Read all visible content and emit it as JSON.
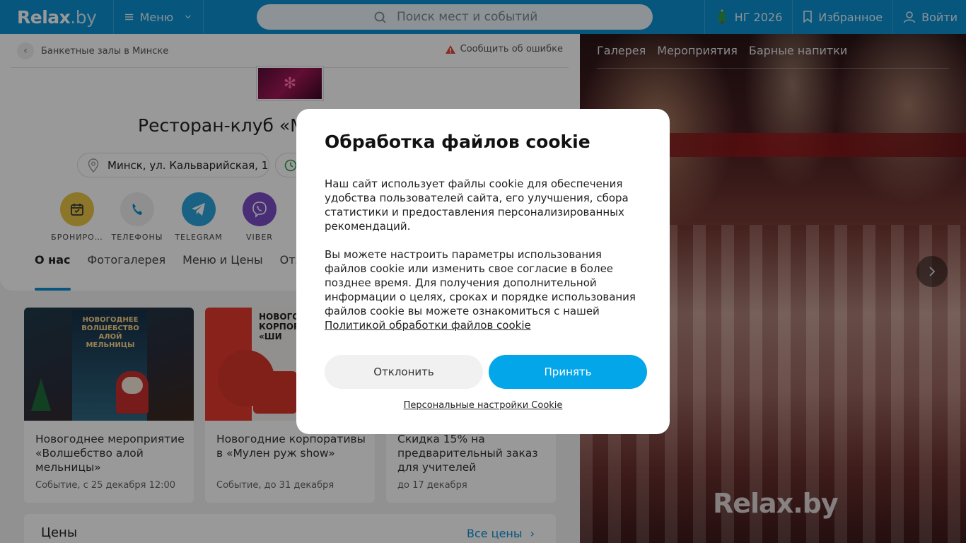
{
  "header": {
    "logo": "Relax",
    "logo_suffix": ".by",
    "menu_label": "Меню",
    "search_placeholder": "Поиск мест и событий",
    "ng_label": "НГ 2026",
    "favorites_label": "Избранное",
    "login_label": "Войти"
  },
  "page": {
    "breadcrumb": "Банкетные залы в Минске",
    "report_label": "Сообщить об ошибке",
    "title": "Ресторан-клуб «М",
    "address": "Минск, ул. Кальварийская, 1",
    "actions": [
      {
        "label": "БРОНИРО…",
        "color": "#e8c547",
        "icon": "calendar-icon"
      },
      {
        "label": "ТЕЛЕФОНЫ",
        "color": "#eeeeee",
        "icon": "phone-icon"
      },
      {
        "label": "TELEGRAM",
        "color": "#2aa3dc",
        "icon": "telegram-icon"
      },
      {
        "label": "VIBER",
        "color": "#7c4cc7",
        "icon": "viber-icon"
      }
    ],
    "tabs": [
      "О нас",
      "Фотогалерея",
      "Меню и Цены",
      "Отз"
    ]
  },
  "events": [
    {
      "title": "Новогоднее мероприятие «Волшебство алой мельницы»",
      "sub": "Событие, с 25 декабря 12:00",
      "poster_heading": "НОВОГОДНЕЕ ВОЛШЕБСТВО АЛОЙ МЕЛЬНИЦЫ"
    },
    {
      "title": "Новогодние корпоративы в «Мулен руж show»",
      "sub": "Событие, до 31 декабря",
      "poster_heading": "НОВОГОД КОРПОРА «ШИ"
    },
    {
      "title": "Скидка 15% на предварительный заказ для учителей",
      "sub": "до 17 декабря",
      "poster_heading": ""
    }
  ],
  "prices": {
    "heading": "Цены",
    "link": "Все цены"
  },
  "gallery": {
    "tabs": [
      "Галерея",
      "Мероприятия",
      "Барные напитки"
    ],
    "watermark": "Relax.by"
  },
  "cookie": {
    "title": "Обработка файлов cookie",
    "paragraph1": "Наш сайт использует файлы cookie для обеспечения удобства пользователей сайта, его улучшения, сбора статистики и предоставления персонализированных рекомендаций.",
    "paragraph2": "Вы можете настроить параметры использования файлов cookie или изменить свое согласие в более позднее время. Для получения дополнительной информации о целях, сроках и порядке использования файлов cookie вы можете ознакомиться с нашей",
    "policy_link": "Политикой обработки файлов cookie",
    "decline": "Отклонить",
    "accept": "Принять",
    "personal": "Персональные настройки Cookie"
  },
  "colors": {
    "brand": "#0a8fd0",
    "accept": "#04a6ea"
  }
}
